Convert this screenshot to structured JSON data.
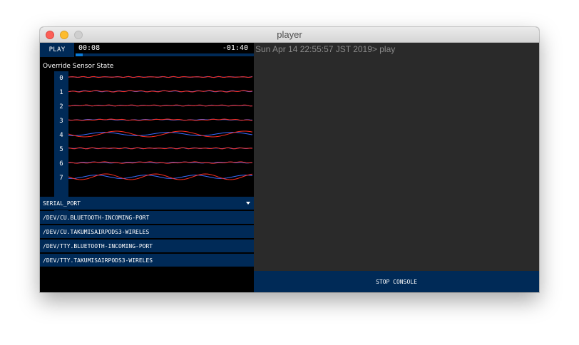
{
  "window": {
    "title": "player"
  },
  "transport": {
    "play_label": "PLAY",
    "elapsed": "00:08",
    "remaining": "-01:40",
    "progress_percent": 4
  },
  "sensor": {
    "title": "Override Sensor State",
    "channels": [
      "0",
      "1",
      "2",
      "3",
      "4",
      "5",
      "6",
      "7"
    ],
    "colors": {
      "red": "#ff2d20",
      "blue": "#3a6bff"
    }
  },
  "serial": {
    "dropdown_label": "SERIAL_PORT",
    "ports": [
      "/DEV/CU.BLUETOOTH-INCOMING-PORT",
      "/DEV/CU.TAKUMISAIRPODS3-WIRELES",
      "/DEV/TTY.BLUETOOTH-INCOMING-PORT",
      "/DEV/TTY.TAKUMISAIRPODS3-WIRELES"
    ]
  },
  "console": {
    "log_line": "Sun Apr 14 22:55:57 JST 2019> play",
    "stop_label": "STOP CONSOLE"
  }
}
